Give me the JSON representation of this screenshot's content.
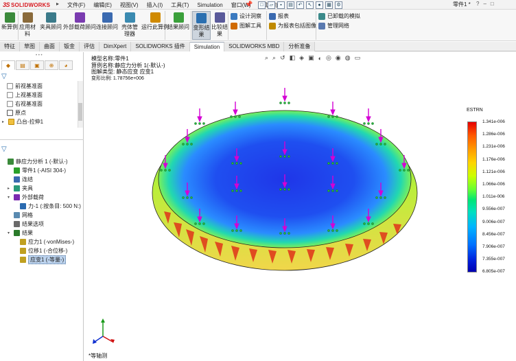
{
  "app": {
    "logo_ds": "3S",
    "logo_text": "SOLIDWORKS",
    "document_title": "零件1 *",
    "menu": [
      "文件(F)",
      "编辑(E)",
      "视图(V)",
      "插入(I)",
      "工具(T)",
      "Simulation",
      "窗口(W)",
      "帮助(H)"
    ]
  },
  "ribbon": {
    "buttons": [
      {
        "label": "新算例",
        "icon": "new-study-icon",
        "color": "#3b8a3b"
      },
      {
        "label": "应用材\n料",
        "icon": "apply-material-icon",
        "color": "#8a6a3b"
      },
      {
        "label": "夹具顾问",
        "icon": "fixture-advisor-icon",
        "color": "#3b7a8a"
      },
      {
        "label": "外部载荷顾问",
        "icon": "load-advisor-icon",
        "color": "#7a3bb0"
      },
      {
        "label": "连接顾问",
        "icon": "connection-advisor-icon",
        "color": "#3b6ab0"
      },
      {
        "label": "壳体管\n理器",
        "icon": "shell-manager-icon",
        "color": "#3b8ab0"
      },
      {
        "label": "运行此算例",
        "icon": "run-study-icon",
        "color": "#d08a00"
      },
      {
        "label": "结果顾问",
        "icon": "results-advisor-icon",
        "color": "#3ba03b"
      },
      {
        "label": "变形结\n果",
        "icon": "deformed-result-icon",
        "color": "#2a6fb0"
      },
      {
        "label": "比较结\n果",
        "icon": "compare-results-icon",
        "color": "#5a5a9a"
      }
    ],
    "small": [
      {
        "label": "设计洞察",
        "icon": "design-insight-icon",
        "color": "#3b7ac0"
      },
      {
        "label": "图解工具",
        "icon": "plot-tools-icon",
        "color": "#d06a00"
      },
      {
        "label": "报表",
        "icon": "report-icon",
        "color": "#3b6ab0"
      },
      {
        "label": "为报表包括图像",
        "icon": "include-image-icon",
        "color": "#c08a00"
      },
      {
        "label": "已卸载的模拟",
        "icon": "offloaded-sim-icon",
        "color": "#3b8a8a"
      },
      {
        "label": "管理网络",
        "icon": "manage-network-icon",
        "color": "#5a7ab0"
      }
    ]
  },
  "tabs": [
    "特征",
    "草图",
    "曲面",
    "钣金",
    "评估",
    "DimXpert",
    "SOLIDWORKS 插件",
    "Simulation",
    "SOLIDWORKS MBD",
    "分析准备"
  ],
  "active_tab": "Simulation",
  "feature_tree": [
    {
      "label": "前视基准面",
      "icon": "plane-icon"
    },
    {
      "label": "上视基准面",
      "icon": "plane-icon"
    },
    {
      "label": "右视基准面",
      "icon": "plane-icon"
    },
    {
      "label": "原点",
      "icon": "origin-icon"
    },
    {
      "label": "凸台-拉伸1",
      "icon": "extrude-icon"
    }
  ],
  "sim_tree": [
    {
      "label": "静应力分析 1 (-默认-)",
      "icon": "static-study-icon",
      "indent": 0,
      "toggle": ""
    },
    {
      "label": "零件1 (-AISI 304-)",
      "icon": "part-icon",
      "indent": 1,
      "toggle": ""
    },
    {
      "label": "连结",
      "icon": "connections-icon",
      "indent": 1,
      "toggle": ""
    },
    {
      "label": "夹具",
      "icon": "fixtures-icon",
      "indent": 1,
      "toggle": "▸"
    },
    {
      "label": "外部载荷",
      "icon": "loads-icon",
      "indent": 1,
      "toggle": "▾"
    },
    {
      "label": "力-1 (:按条目: 500 N:)",
      "icon": "force-icon",
      "indent": 2,
      "toggle": ""
    },
    {
      "label": "网格",
      "icon": "mesh-icon",
      "indent": 1,
      "toggle": ""
    },
    {
      "label": "结果选项",
      "icon": "result-options-icon",
      "indent": 1,
      "toggle": ""
    },
    {
      "label": "结果",
      "icon": "results-folder-icon",
      "indent": 1,
      "toggle": "▾"
    },
    {
      "label": "应力1 (-vonMises-)",
      "icon": "plot-icon",
      "indent": 2,
      "toggle": ""
    },
    {
      "label": "位移1 (-合位移-)",
      "icon": "plot-icon",
      "indent": 2,
      "toggle": ""
    },
    {
      "label": "应变1 (-等量-)",
      "icon": "plot-icon",
      "indent": 2,
      "toggle": "",
      "selected": true
    }
  ],
  "info": {
    "model_name": "模型名称:零件1",
    "study_name": "算例名称:静应力分析 1(-默认-)",
    "plot_type": "图解类型: 静态应变 应变1",
    "scale": "变形比例: 1.78756e+006"
  },
  "legend": {
    "title": "ESTRN",
    "labels": [
      "1.341e-006",
      "1.286e-006",
      "1.231e-006",
      "1.176e-006",
      "1.121e-006",
      "1.066e-006",
      "1.011e-006",
      "9.556e-007",
      "9.006e-007",
      "8.456e-007",
      "7.906e-007",
      "7.355e-007",
      "6.805e-007"
    ]
  },
  "view_name": "*等轴测"
}
